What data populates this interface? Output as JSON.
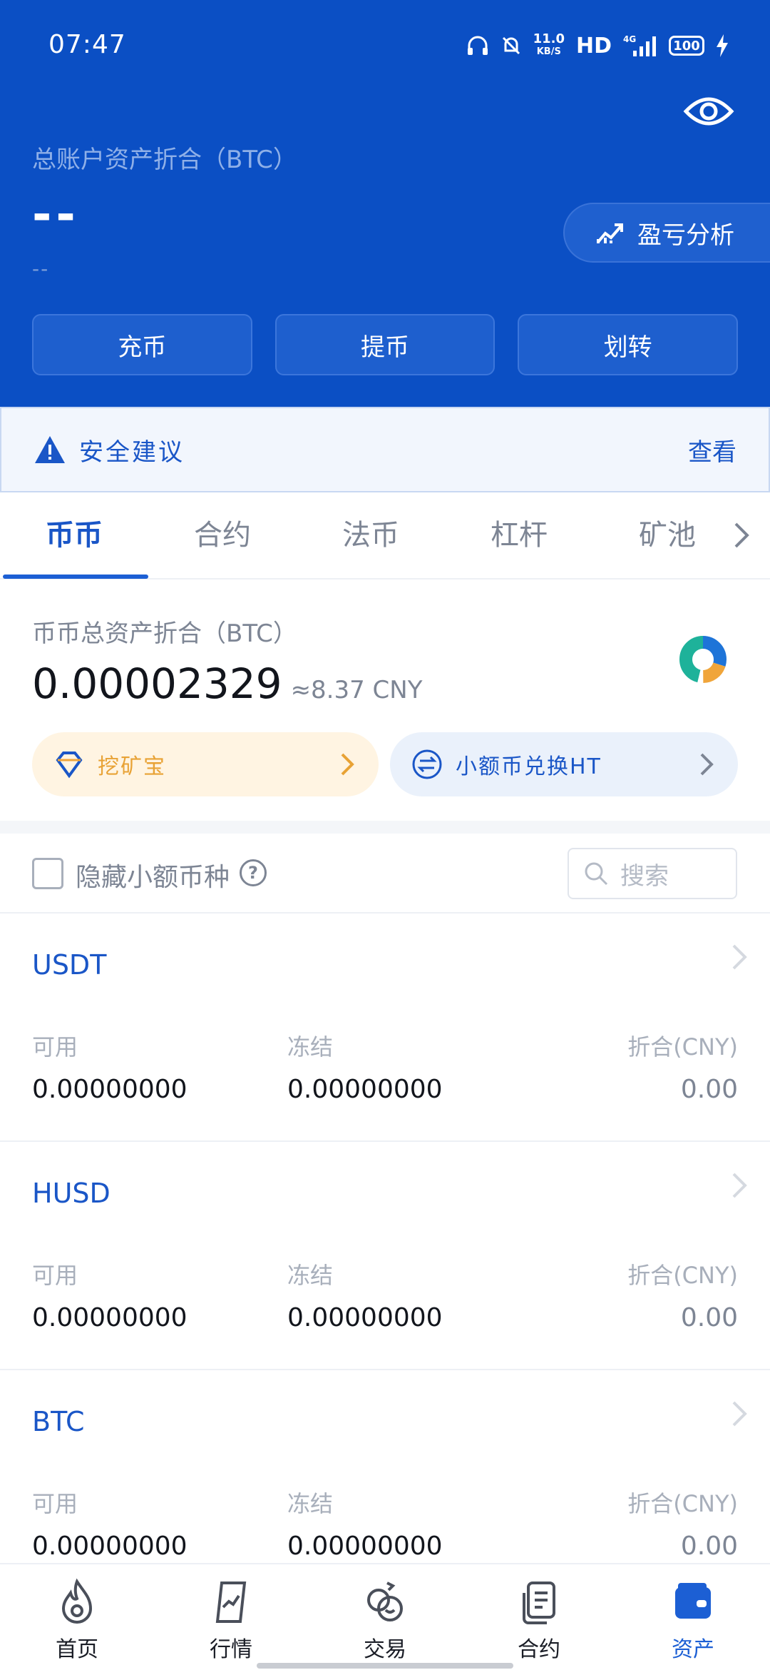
{
  "status_bar": {
    "time": "07:47",
    "net_speed_value": "11.0",
    "net_speed_unit": "KB/S",
    "hd": "HD",
    "network": "4G",
    "battery": "100",
    "icons": [
      "headset-icon",
      "mute-bell-icon",
      "signal-icon",
      "charging-icon"
    ]
  },
  "header": {
    "total_label": "总账户资产折合（BTC）",
    "total_value": "--",
    "total_sub": "--",
    "pnl_label": "盈亏分析",
    "actions": [
      "充币",
      "提币",
      "划转"
    ]
  },
  "security": {
    "title": "安全建议",
    "view": "查看"
  },
  "tabs": [
    "币币",
    "合约",
    "法币",
    "杠杆",
    "矿池"
  ],
  "account": {
    "label": "币币总资产折合（BTC）",
    "value": "0.00002329",
    "cny": "≈8.37 CNY",
    "promo_mining": "挖矿宝",
    "promo_swap": "小额币兑换HT"
  },
  "filter": {
    "hide_small": "隐藏小额币种",
    "help": "?",
    "search_placeholder": "搜索"
  },
  "coins": [
    {
      "name": "USDT",
      "available_label": "可用",
      "available": "0.00000000",
      "frozen_label": "冻结",
      "frozen": "0.00000000",
      "cny_label": "折合(CNY)",
      "cny": "0.00"
    },
    {
      "name": "HUSD",
      "available_label": "可用",
      "available": "0.00000000",
      "frozen_label": "冻结",
      "frozen": "0.00000000",
      "cny_label": "折合(CNY)",
      "cny": "0.00"
    },
    {
      "name": "BTC",
      "available_label": "可用",
      "available": "0.00000000",
      "frozen_label": "冻结",
      "frozen": "0.00000000",
      "cny_label": "折合(CNY)",
      "cny": "0.00"
    }
  ],
  "bottom_nav": [
    "首页",
    "行情",
    "交易",
    "合约",
    "资产"
  ],
  "colors": {
    "brand_blue": "#0b4fc4",
    "accent_blue": "#1c5fd4",
    "mining_orange": "#e8a235"
  }
}
